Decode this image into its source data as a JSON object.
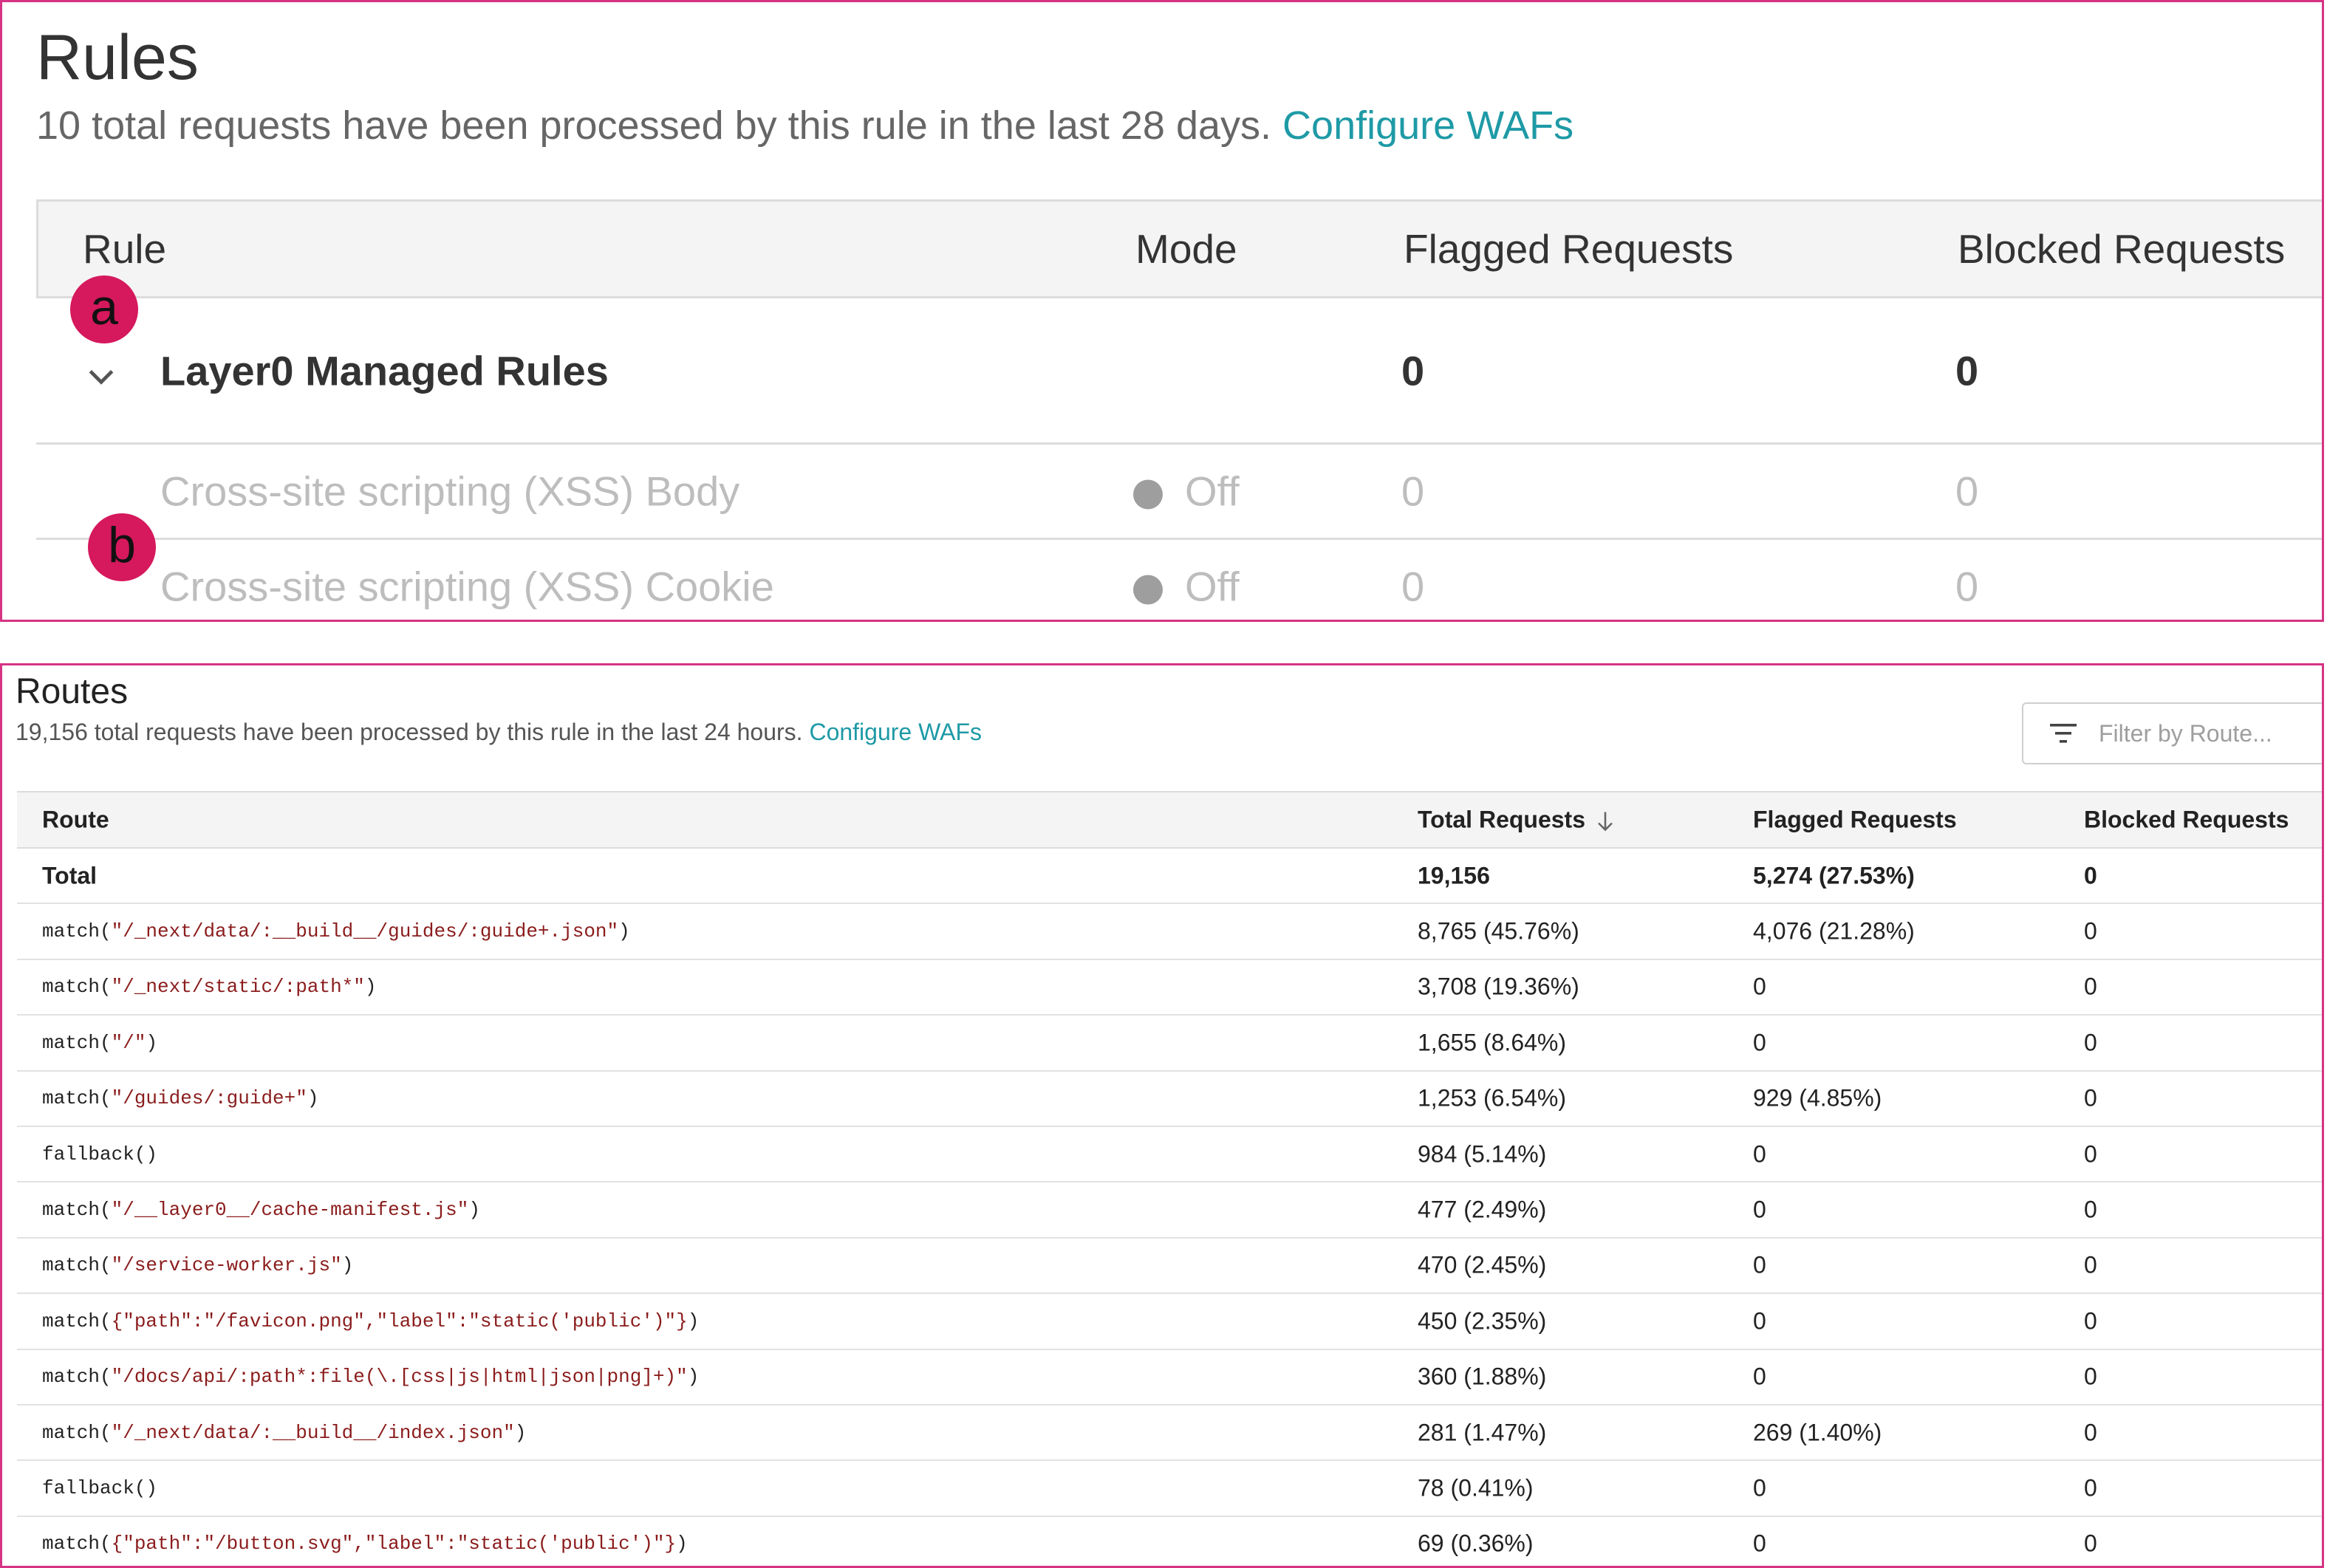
{
  "colors": {
    "panel_border": "#d63384",
    "link": "#1e9aa6",
    "badge": "#d6185c",
    "muted_text": "#bdbdbd",
    "string_literal": "#8b1c1c"
  },
  "rules": {
    "title": "Rules",
    "subtitle": "10 total requests have been processed by this rule in the last 28 days.",
    "link": "Configure WAFs",
    "columns": [
      "Rule",
      "Mode",
      "Flagged Requests",
      "Blocked Requests"
    ],
    "group": {
      "name": "Layer0 Managed Rules",
      "flagged": "0",
      "blocked": "0",
      "icon": "chevron-down-icon"
    },
    "subrules": [
      {
        "name": "Cross-site scripting (XSS) Body",
        "mode": "Off",
        "flagged": "0",
        "blocked": "0"
      },
      {
        "name": "Cross-site scripting (XSS) Cookie",
        "mode": "Off",
        "flagged": "0",
        "blocked": "0"
      }
    ],
    "badges": [
      "a",
      "b"
    ]
  },
  "routes": {
    "title": "Routes",
    "subtitle": "19,156 total requests have been processed by this rule in the last 24 hours.",
    "link": "Configure WAFs",
    "filter_placeholder": "Filter by Route...",
    "columns": [
      "Route",
      "Total Requests",
      "Flagged Requests",
      "Blocked Requests"
    ],
    "sort_icon": "arrow-down-icon",
    "total_row": {
      "route": "Total",
      "total": "19,156",
      "flagged": "5,274 (27.53%)",
      "blocked": "0"
    },
    "rows": [
      {
        "pre": "match(",
        "str": "\"/_next/data/:__build__/guides/:guide+.json\"",
        "post": ")",
        "total": "8,765 (45.76%)",
        "flagged": "4,076 (21.28%)",
        "blocked": "0"
      },
      {
        "pre": "match(",
        "str": "\"/_next/static/:path*\"",
        "post": ")",
        "total": "3,708 (19.36%)",
        "flagged": "0",
        "blocked": "0"
      },
      {
        "pre": "match(",
        "str": "\"/\"",
        "post": ")",
        "total": "1,655 (8.64%)",
        "flagged": "0",
        "blocked": "0"
      },
      {
        "pre": "match(",
        "str": "\"/guides/:guide+\"",
        "post": ")",
        "total": "1,253 (6.54%)",
        "flagged": "929 (4.85%)",
        "blocked": "0"
      },
      {
        "pre": "fallback()",
        "str": "",
        "post": "",
        "total": "984 (5.14%)",
        "flagged": "0",
        "blocked": "0"
      },
      {
        "pre": "match(",
        "str": "\"/__layer0__/cache-manifest.js\"",
        "post": ")",
        "total": "477 (2.49%)",
        "flagged": "0",
        "blocked": "0"
      },
      {
        "pre": "match(",
        "str": "\"/service-worker.js\"",
        "post": ")",
        "total": "470 (2.45%)",
        "flagged": "0",
        "blocked": "0"
      },
      {
        "pre": "match(",
        "str": "{\"path\":\"/favicon.png\",\"label\":\"static('public')\"}",
        "post": ")",
        "total": "450 (2.35%)",
        "flagged": "0",
        "blocked": "0"
      },
      {
        "pre": "match(",
        "str": "\"/docs/api/:path*:file(\\.[css|js|html|json|png]+)\"",
        "post": ")",
        "total": "360 (1.88%)",
        "flagged": "0",
        "blocked": "0"
      },
      {
        "pre": "match(",
        "str": "\"/_next/data/:__build__/index.json\"",
        "post": ")",
        "total": "281 (1.47%)",
        "flagged": "269 (1.40%)",
        "blocked": "0"
      },
      {
        "pre": "fallback()",
        "str": "",
        "post": "",
        "total": "78 (0.41%)",
        "flagged": "0",
        "blocked": "0"
      },
      {
        "pre": "match(",
        "str": "{\"path\":\"/button.svg\",\"label\":\"static('public')\"}",
        "post": ")",
        "total": "69 (0.36%)",
        "flagged": "0",
        "blocked": "0"
      }
    ]
  }
}
